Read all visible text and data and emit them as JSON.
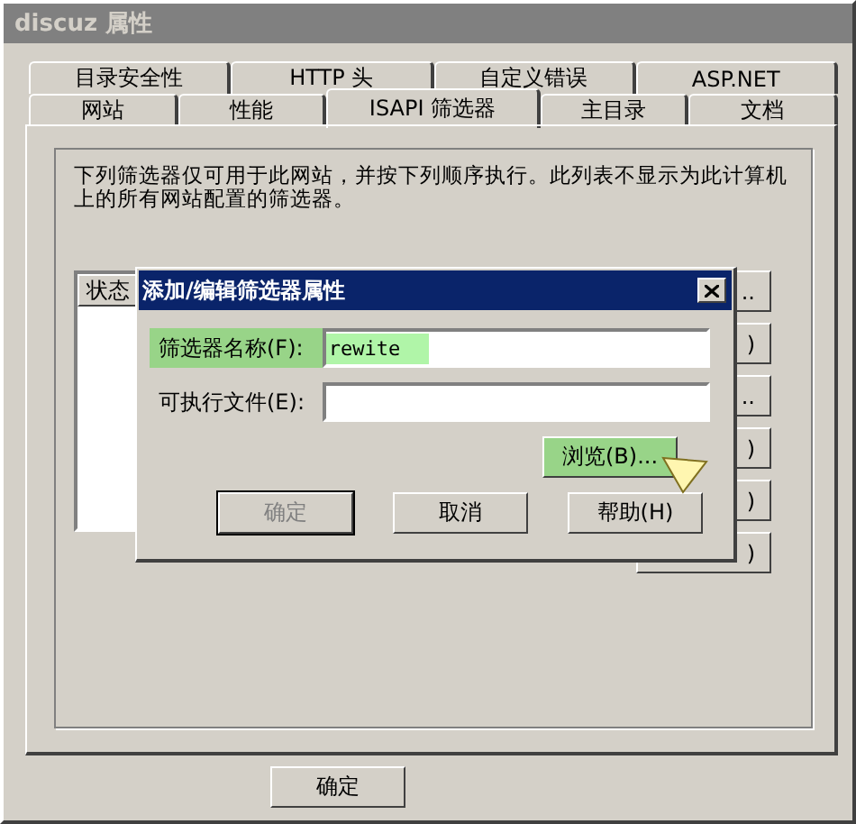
{
  "window": {
    "title": "discuz 属性"
  },
  "tab_rows": [
    [
      {
        "label": "目录安全性",
        "selected": false
      },
      {
        "label": "HTTP 头",
        "selected": false
      },
      {
        "label": "自定义错误",
        "selected": false
      },
      {
        "label": "ASP.NET",
        "selected": false
      }
    ],
    [
      {
        "label": "网站",
        "selected": false
      },
      {
        "label": "性能",
        "selected": false
      },
      {
        "label": "ISAPI 筛选器",
        "selected": true
      },
      {
        "label": "主目录",
        "selected": false
      },
      {
        "label": "文档",
        "selected": false
      }
    ]
  ],
  "description": "下列筛选器仅可用于此网站，并按下列顺序执行。此列表不显示为此计算机上的所有网站配置的筛选器。",
  "filter_list": {
    "columns": [
      "状态"
    ]
  },
  "side_buttons": [
    "..",
    ")",
    "..",
    ")",
    ")",
    ")"
  ],
  "dialog": {
    "title": "添加/编辑筛选器属性",
    "fields": [
      {
        "label": "筛选器名称(F):",
        "value": "rewite",
        "highlighted": true
      },
      {
        "label": "可执行文件(E):",
        "highlighted": false
      }
    ],
    "browse": {
      "label": "浏览(B)...",
      "highlighted": true
    },
    "buttons": [
      {
        "label": "确定",
        "disabled": true
      },
      {
        "label": "取消",
        "disabled": false
      },
      {
        "label": "帮助(H)",
        "disabled": false
      }
    ]
  },
  "footer_buttons": [
    "确定"
  ]
}
